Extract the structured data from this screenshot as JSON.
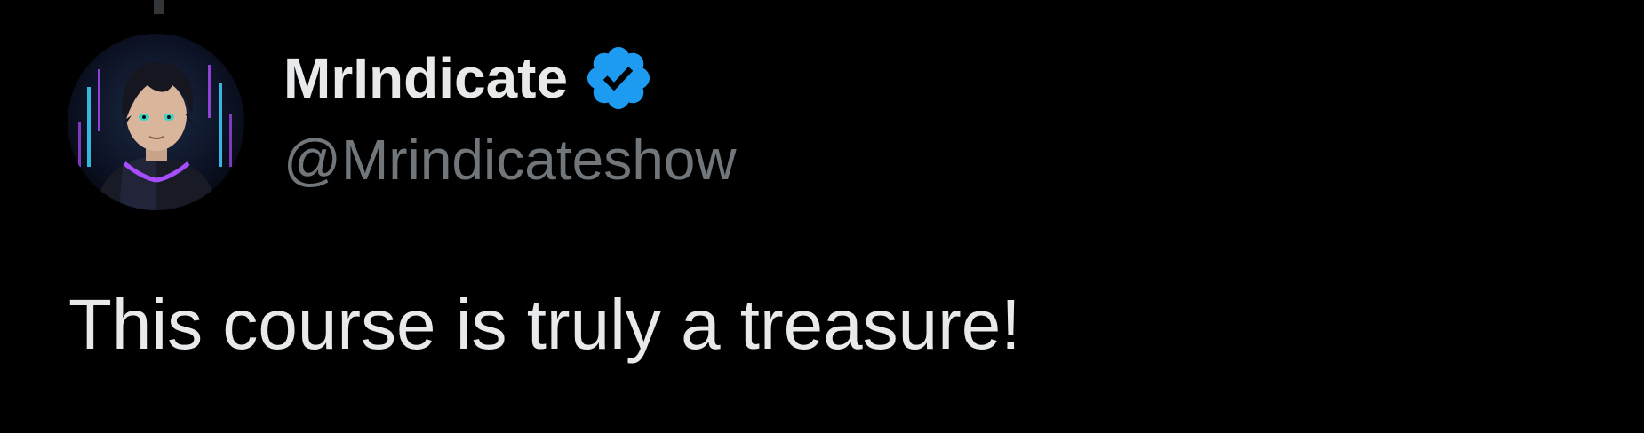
{
  "tweet": {
    "author": {
      "display_name": "MrIndicate",
      "handle": "@Mrindicateshow",
      "verified": true,
      "avatar_icon": "anime-character-avatar"
    },
    "text": "This course is truly a treasure!"
  },
  "colors": {
    "background": "#000000",
    "primary_text": "#e7e9ea",
    "secondary_text": "#71767b",
    "verified_badge": "#1d9bf0",
    "thread_line": "#333639"
  }
}
